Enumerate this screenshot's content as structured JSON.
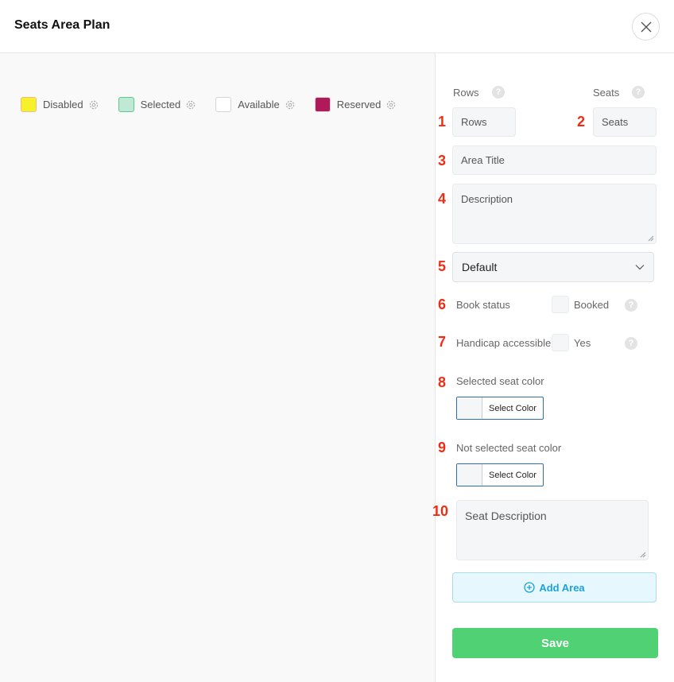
{
  "modal": {
    "title": "Seats Area Plan"
  },
  "legend": [
    {
      "label": "Disabled",
      "fill": "#f5f22a",
      "border": "#f4b98a"
    },
    {
      "label": "Selected",
      "fill": "#bfe9d4",
      "border": "#5ccb8e"
    },
    {
      "label": "Available",
      "fill": "#ffffff",
      "border": "#d5d5d5"
    },
    {
      "label": "Reserved",
      "fill": "#b01a5b",
      "border": "#d5d5d5"
    }
  ],
  "form": {
    "rows_label": "Rows",
    "seats_label": "Seats",
    "rows_placeholder": "Rows",
    "seats_placeholder": "Seats",
    "area_title_placeholder": "Area Title",
    "description_placeholder": "Description",
    "select_value": "Default",
    "book_status_label": "Book status",
    "book_status_option": "Booked",
    "handicap_label": "Handicap accessible",
    "handicap_option": "Yes",
    "selected_color_label": "Selected seat color",
    "not_selected_color_label": "Not selected seat color",
    "select_color_button": "Select Color",
    "seat_description_placeholder": "Seat Description",
    "add_area_button": "Add Area",
    "save_button": "Save"
  },
  "markers": [
    "1",
    "2",
    "3",
    "4",
    "5",
    "6",
    "7",
    "8",
    "9",
    "10"
  ],
  "help_glyph": "?",
  "colors": {
    "accent_red": "#ee2e14",
    "save_green": "#4fd174",
    "add_area_blue": "#1ca2dd"
  }
}
